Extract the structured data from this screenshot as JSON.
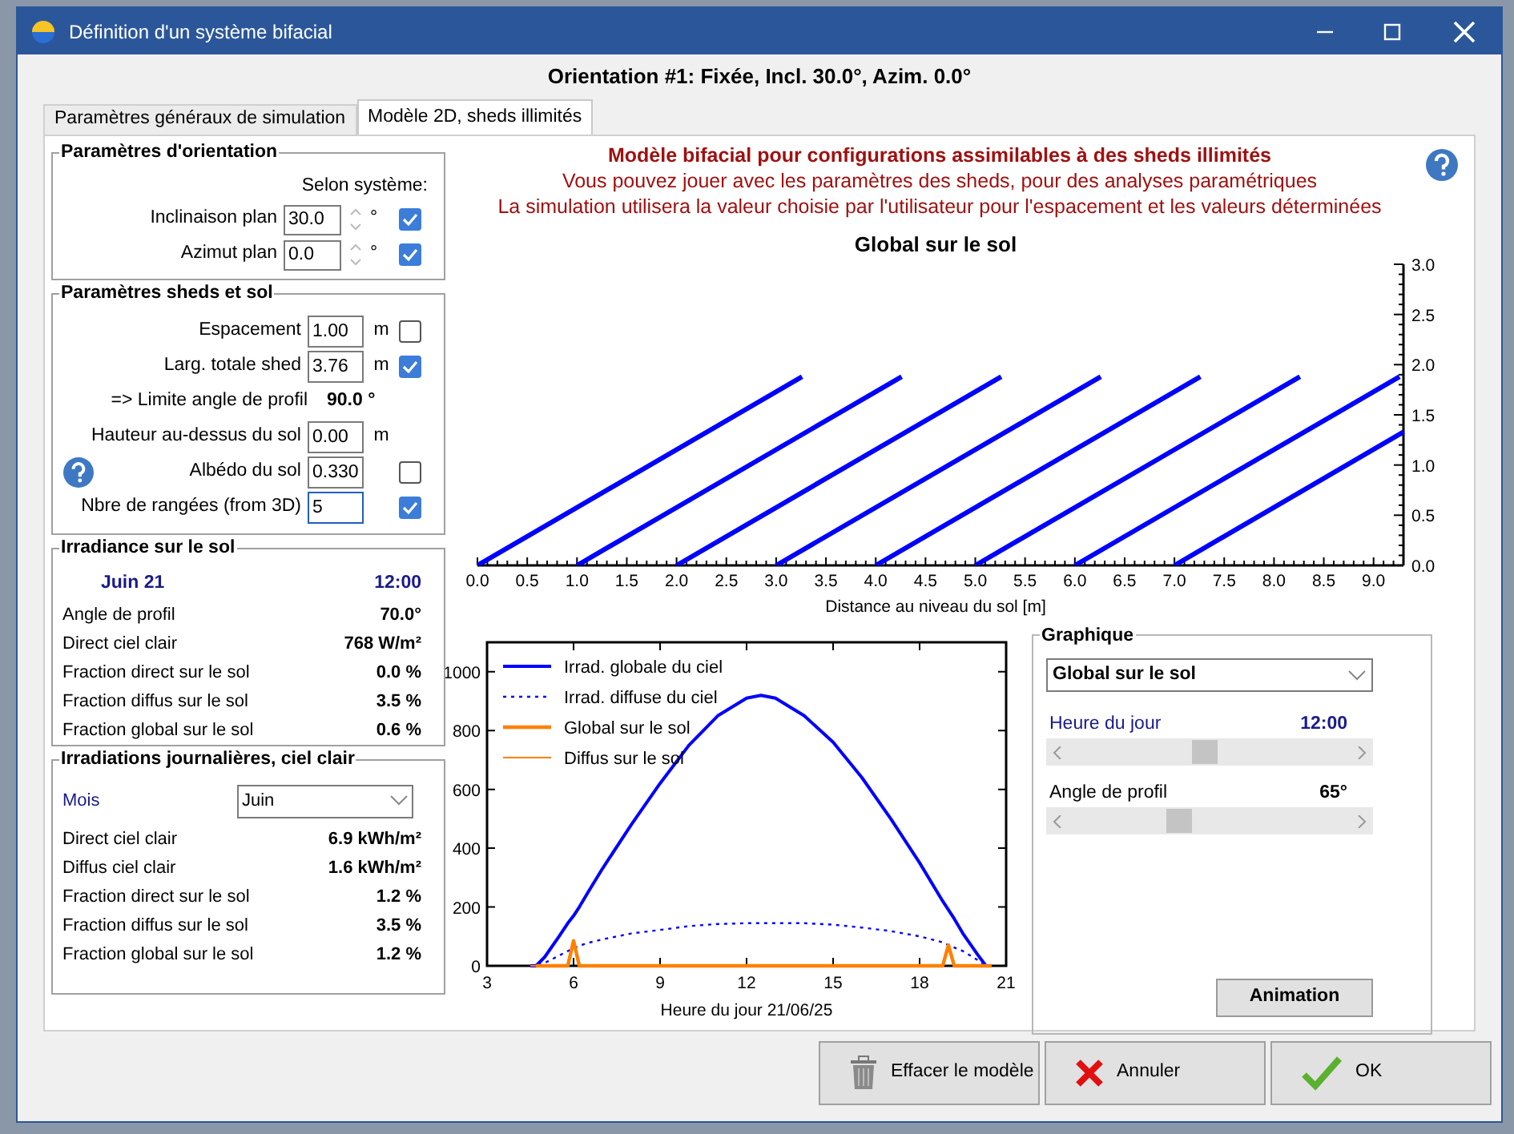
{
  "window": {
    "title": "Définition d'un système bifacial"
  },
  "heading": "Orientation #1: Fixée, Incl. 30.0°, Azim. 0.0°",
  "tabs": [
    {
      "label": "Paramètres généraux de simulation",
      "selected": false
    },
    {
      "label": "Modèle 2D, sheds illimités",
      "selected": true
    }
  ],
  "orientation_group": {
    "title": "Paramètres d'orientation",
    "column_label": "Selon système:",
    "fields": [
      {
        "label": "Inclinaison plan",
        "value": "30.0",
        "unit": "°",
        "checked": true
      },
      {
        "label": "Azimut plan",
        "value": "0.0",
        "unit": "°",
        "checked": true
      }
    ]
  },
  "sheds_group": {
    "title": "Paramètres sheds et sol",
    "rows": [
      {
        "kind": "field",
        "label": "Espacement",
        "value": "1.00",
        "unit": "m",
        "checked": false,
        "focused": false,
        "help": false
      },
      {
        "kind": "field",
        "label": "Larg. totale shed",
        "value": "3.76",
        "unit": "m",
        "checked": true,
        "focused": false,
        "help": false
      },
      {
        "kind": "readout",
        "label": "=> Limite angle de profil",
        "value": "90.0 °"
      },
      {
        "kind": "field",
        "label": "Hauteur au-dessus du sol",
        "value": "0.00",
        "unit": "m",
        "focused": false,
        "help": false
      },
      {
        "kind": "field",
        "label": "Albédo du sol",
        "value": "0.330",
        "checked": false,
        "focused": false,
        "help": true
      },
      {
        "kind": "field",
        "label": "Nbre de rangées (from 3D)",
        "value": "5",
        "checked": true,
        "focused": true,
        "help": false
      }
    ]
  },
  "irradiance_group": {
    "title": "Irradiance sur le sol",
    "date": "Juin 21",
    "time": "12:00",
    "rows": [
      {
        "label": "Angle de profil",
        "value": "70.0°"
      },
      {
        "label": "Direct ciel clair",
        "value": "768 W/m²"
      },
      {
        "label": "Fraction direct sur le sol",
        "value": "0.0 %"
      },
      {
        "label": "Fraction diffus sur le sol",
        "value": "3.5 %"
      },
      {
        "label": "Fraction global sur le sol",
        "value": "0.6 %"
      }
    ]
  },
  "daily_group": {
    "title": "Irradiations journalières, ciel clair",
    "month_label": "Mois",
    "month_value": "Juin",
    "rows": [
      {
        "label": "Direct ciel clair",
        "value": "6.9 kWh/m²"
      },
      {
        "label": "Diffus ciel clair",
        "value": "1.6 kWh/m²"
      },
      {
        "label": "Fraction direct sur le sol",
        "value": "1.2 %"
      },
      {
        "label": "Fraction diffus sur le sol",
        "value": "3.5 %"
      },
      {
        "label": "Fraction global sur le sol",
        "value": "1.2 %"
      }
    ]
  },
  "model_info": {
    "title": "Modèle bifacial pour configurations assimilables à des sheds illimités",
    "lines": [
      "Vous pouvez jouer avec les paramètres des sheds, pour des analyses paramétriques",
      "La simulation utilisera la valeur choisie par l'utilisateur pour l'espacement et les valeurs déterminées"
    ]
  },
  "profile_chart": {
    "chart_data": {
      "type": "line",
      "title": "Global sur le sol",
      "xlabel": "Distance au niveau du sol [m]",
      "xlim": [
        0,
        9.3
      ],
      "ylim": [
        0,
        3
      ],
      "xticks": [
        {
          "value": 0,
          "label": "0.0"
        },
        {
          "value": 0.5,
          "label": "0.5"
        },
        {
          "value": 1,
          "label": "1.0"
        },
        {
          "value": 1.5,
          "label": "1.5"
        },
        {
          "value": 2,
          "label": "2.0"
        },
        {
          "value": 2.5,
          "label": "2.5"
        },
        {
          "value": 3,
          "label": "3.0"
        },
        {
          "value": 3.5,
          "label": "3.5"
        },
        {
          "value": 4,
          "label": "4.0"
        },
        {
          "value": 4.5,
          "label": "4.5"
        },
        {
          "value": 5,
          "label": "5.0"
        },
        {
          "value": 5.5,
          "label": "5.5"
        },
        {
          "value": 6,
          "label": "6.0"
        },
        {
          "value": 6.5,
          "label": "6.5"
        },
        {
          "value": 7,
          "label": "7.0"
        },
        {
          "value": 7.5,
          "label": "7.5"
        },
        {
          "value": 8,
          "label": "8.0"
        },
        {
          "value": 8.5,
          "label": "8.5"
        },
        {
          "value": 9,
          "label": "9.0"
        }
      ],
      "yticks": [
        {
          "value": 0,
          "label": "0.0"
        },
        {
          "value": 0.5,
          "label": "0.5"
        },
        {
          "value": 1,
          "label": "1.0"
        },
        {
          "value": 1.5,
          "label": "1.5"
        },
        {
          "value": 2,
          "label": "2.0"
        },
        {
          "value": 2.5,
          "label": "2.5"
        },
        {
          "value": 3,
          "label": "3.0"
        }
      ],
      "series": [
        {
          "color": "#0000ff",
          "x": [
            0,
            3.26
          ],
          "values": [
            0,
            1.88
          ]
        },
        {
          "color": "#0000ff",
          "x": [
            1,
            4.26
          ],
          "values": [
            0,
            1.88
          ]
        },
        {
          "color": "#0000ff",
          "x": [
            2,
            5.26
          ],
          "values": [
            0,
            1.88
          ]
        },
        {
          "color": "#0000ff",
          "x": [
            3,
            6.26
          ],
          "values": [
            0,
            1.88
          ]
        },
        {
          "color": "#0000ff",
          "x": [
            4,
            7.26
          ],
          "values": [
            0,
            1.88
          ]
        },
        {
          "color": "#0000ff",
          "x": [
            5,
            8.26
          ],
          "values": [
            0,
            1.88
          ]
        },
        {
          "color": "#0000ff",
          "x": [
            6,
            9.26
          ],
          "values": [
            0,
            1.88
          ]
        },
        {
          "color": "#0000ff",
          "x": [
            7,
            9.3
          ],
          "values": [
            0,
            1.33
          ]
        }
      ]
    }
  },
  "daily_chart": {
    "chart_data": {
      "type": "line",
      "xlabel": "Heure du jour 21/06/25",
      "xlim": [
        3,
        21
      ],
      "ylim": [
        0,
        1100
      ],
      "xticks": [
        3,
        6,
        9,
        12,
        15,
        18,
        21
      ],
      "yticks": [
        0,
        200,
        400,
        600,
        800,
        1000
      ],
      "legend": true,
      "x": [
        4.5,
        4.7,
        5,
        5.5,
        5.8,
        6,
        6.2,
        6.5,
        7,
        8,
        9,
        10,
        11,
        12,
        12.5,
        13,
        14,
        15,
        16,
        17,
        18,
        18.8,
        19,
        19.2,
        19.5,
        20,
        20.3,
        20.5
      ],
      "series": [
        {
          "name": "Irrad. globale du ciel",
          "color": "#0000ff",
          "line_style": "solid",
          "values": [
            0,
            0,
            30,
            100,
            145,
            170,
            200,
            250,
            330,
            480,
            620,
            750,
            850,
            910,
            920,
            910,
            850,
            760,
            640,
            500,
            350,
            220,
            190,
            160,
            110,
            40,
            0,
            0
          ]
        },
        {
          "name": "Irrad. diffuse du ciel",
          "color": "#0000ff",
          "line_style": "dotted",
          "values": [
            0,
            0,
            10,
            35,
            50,
            60,
            68,
            78,
            90,
            110,
            122,
            135,
            142,
            145,
            145,
            145,
            145,
            140,
            130,
            118,
            100,
            80,
            70,
            62,
            50,
            20,
            0,
            0
          ]
        },
        {
          "name": "Global sur le sol",
          "color": "#ff8000",
          "line_style": "solid",
          "values": [
            null,
            0,
            0,
            0,
            0,
            85,
            0,
            0,
            0,
            0,
            0,
            0,
            0,
            0,
            0,
            0,
            0,
            0,
            0,
            0,
            0,
            0,
            70,
            0,
            0,
            0,
            0,
            0
          ]
        },
        {
          "name": "Diffus sur le sol",
          "color": "#ff8000",
          "line_style": "solid",
          "values": [
            0,
            0,
            0,
            0,
            0,
            80,
            0,
            0,
            0,
            0,
            0,
            0,
            0,
            0,
            0,
            0,
            0,
            0,
            0,
            0,
            0,
            0,
            65,
            0,
            0,
            0,
            0,
            0
          ]
        }
      ]
    }
  },
  "graph_group": {
    "title": "Graphique",
    "dropdown": "Global sur le sol",
    "sliders": [
      {
        "label": "Heure du jour",
        "reading": "12:00",
        "level": 0.48,
        "active": true
      },
      {
        "label": "Angle de profil",
        "reading": "65°",
        "level": 0.38,
        "active": false
      }
    ],
    "animation_button": "Animation"
  },
  "buttons": [
    {
      "label": "Effacer le modèle",
      "kind": "delete"
    },
    {
      "label": "Annuler",
      "kind": "cancel"
    },
    {
      "label": "OK",
      "kind": "ok"
    }
  ]
}
